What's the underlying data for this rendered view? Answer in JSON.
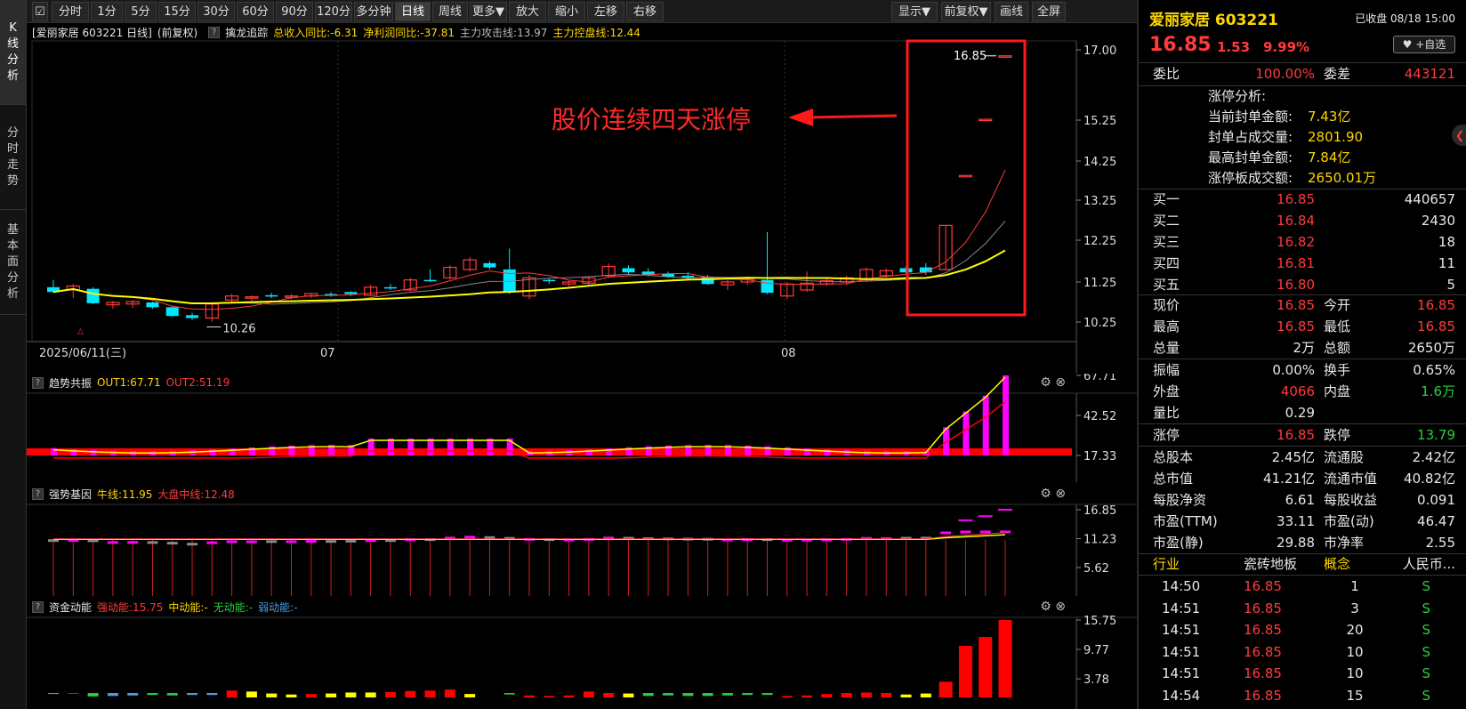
{
  "left_tabs": [
    {
      "chars": [
        "K",
        "线",
        "分",
        "析"
      ]
    },
    {
      "chars": [
        "分",
        "时",
        "走",
        "势"
      ]
    },
    {
      "chars": [
        "基",
        "本",
        "面",
        "分",
        "析"
      ]
    }
  ],
  "toolbar": {
    "items": [
      "分时",
      "1分",
      "5分",
      "15分",
      "30分",
      "60分",
      "90分",
      "120分",
      "多分钟",
      "日线",
      "周线",
      "更多▼",
      "放大",
      "缩小",
      "左移",
      "右移"
    ],
    "right": [
      "显示▼",
      "前复权▼",
      "画线",
      "全屏"
    ],
    "active": "日线"
  },
  "main": {
    "title": "[爱丽家居 603221 日线]",
    "adj": "(前复权)",
    "qmark": "?",
    "indicator_name": "擒龙追踪",
    "ind1": "总收入同比:-6.31",
    "ind2": "净利润同比:-37.81",
    "ind3": "主力攻击线:13.97",
    "ind4": "主力控盘线:12.44",
    "y_ticks": [
      "17.00",
      "15.25",
      "14.25",
      "13.25",
      "12.25",
      "11.25",
      "10.25"
    ],
    "x_labels": [
      "2025/06/11(三)",
      "07",
      "08"
    ],
    "low_label": "10.26",
    "high_label": "16.85",
    "annotation": "股价连续四天涨停"
  },
  "chart_data": {
    "type": "candlestick",
    "y_ticks": [
      10.25,
      11.25,
      12.25,
      13.25,
      14.25,
      15.25,
      17.0
    ],
    "candles": [
      {
        "o": 11.12,
        "h": 11.3,
        "l": 10.98,
        "c": 11.0
      },
      {
        "o": 11.05,
        "h": 11.2,
        "l": 10.85,
        "c": 11.15
      },
      {
        "o": 11.08,
        "h": 11.12,
        "l": 10.7,
        "c": 10.72
      },
      {
        "o": 10.68,
        "h": 10.78,
        "l": 10.58,
        "c": 10.74
      },
      {
        "o": 10.7,
        "h": 10.8,
        "l": 10.6,
        "c": 10.76
      },
      {
        "o": 10.74,
        "h": 10.76,
        "l": 10.58,
        "c": 10.62
      },
      {
        "o": 10.62,
        "h": 10.64,
        "l": 10.38,
        "c": 10.4
      },
      {
        "o": 10.42,
        "h": 10.48,
        "l": 10.3,
        "c": 10.35
      },
      {
        "o": 10.35,
        "h": 10.75,
        "l": 10.26,
        "c": 10.7
      },
      {
        "o": 10.8,
        "h": 10.95,
        "l": 10.75,
        "c": 10.9
      },
      {
        "o": 10.85,
        "h": 10.92,
        "l": 10.78,
        "c": 10.88
      },
      {
        "o": 10.92,
        "h": 10.98,
        "l": 10.85,
        "c": 10.9
      },
      {
        "o": 10.9,
        "h": 10.95,
        "l": 10.82,
        "c": 10.9
      },
      {
        "o": 10.9,
        "h": 10.98,
        "l": 10.85,
        "c": 10.96
      },
      {
        "o": 10.95,
        "h": 11.0,
        "l": 10.88,
        "c": 10.93
      },
      {
        "o": 11.0,
        "h": 11.02,
        "l": 10.9,
        "c": 10.95
      },
      {
        "o": 10.92,
        "h": 11.18,
        "l": 10.9,
        "c": 11.12
      },
      {
        "o": 11.12,
        "h": 11.2,
        "l": 11.05,
        "c": 11.1
      },
      {
        "o": 11.05,
        "h": 11.35,
        "l": 11.02,
        "c": 11.3
      },
      {
        "o": 11.3,
        "h": 11.55,
        "l": 11.25,
        "c": 11.28
      },
      {
        "o": 11.35,
        "h": 11.65,
        "l": 11.3,
        "c": 11.6
      },
      {
        "o": 11.55,
        "h": 11.85,
        "l": 11.5,
        "c": 11.78
      },
      {
        "o": 11.7,
        "h": 11.75,
        "l": 11.55,
        "c": 11.6
      },
      {
        "o": 11.55,
        "h": 12.05,
        "l": 10.95,
        "c": 11.0
      },
      {
        "o": 10.9,
        "h": 11.42,
        "l": 10.82,
        "c": 11.35
      },
      {
        "o": 11.3,
        "h": 11.35,
        "l": 11.2,
        "c": 11.28
      },
      {
        "o": 11.2,
        "h": 11.28,
        "l": 11.15,
        "c": 11.25
      },
      {
        "o": 11.22,
        "h": 11.38,
        "l": 11.18,
        "c": 11.35
      },
      {
        "o": 11.4,
        "h": 11.7,
        "l": 11.35,
        "c": 11.62
      },
      {
        "o": 11.58,
        "h": 11.65,
        "l": 11.42,
        "c": 11.48
      },
      {
        "o": 11.5,
        "h": 11.58,
        "l": 11.38,
        "c": 11.42
      },
      {
        "o": 11.45,
        "h": 11.5,
        "l": 11.35,
        "c": 11.38
      },
      {
        "o": 11.4,
        "h": 11.48,
        "l": 11.32,
        "c": 11.36
      },
      {
        "o": 11.38,
        "h": 11.42,
        "l": 11.18,
        "c": 11.2
      },
      {
        "o": 11.18,
        "h": 11.3,
        "l": 11.05,
        "c": 11.25
      },
      {
        "o": 11.25,
        "h": 11.38,
        "l": 11.18,
        "c": 11.32
      },
      {
        "o": 11.3,
        "h": 12.45,
        "l": 10.95,
        "c": 10.98
      },
      {
        "o": 10.9,
        "h": 11.25,
        "l": 10.82,
        "c": 11.2
      },
      {
        "o": 11.05,
        "h": 11.5,
        "l": 11.0,
        "c": 11.22
      },
      {
        "o": 11.2,
        "h": 11.35,
        "l": 11.15,
        "c": 11.28
      },
      {
        "o": 11.25,
        "h": 11.4,
        "l": 11.18,
        "c": 11.35
      },
      {
        "o": 11.3,
        "h": 11.6,
        "l": 11.25,
        "c": 11.55
      },
      {
        "o": 11.4,
        "h": 11.58,
        "l": 11.35,
        "c": 11.52
      },
      {
        "o": 11.58,
        "h": 11.62,
        "l": 11.45,
        "c": 11.48
      },
      {
        "o": 11.6,
        "h": 11.7,
        "l": 11.42,
        "c": 11.48
      },
      {
        "o": 11.55,
        "h": 12.62,
        "l": 11.52,
        "c": 12.62
      },
      {
        "o": 13.88,
        "h": 13.88,
        "l": 13.88,
        "c": 13.88
      },
      {
        "o": 15.27,
        "h": 15.27,
        "l": 15.27,
        "c": 15.27
      },
      {
        "o": 16.85,
        "h": 16.85,
        "l": 16.85,
        "c": 16.85
      }
    ]
  },
  "ind_trend": {
    "name": "趋势共振",
    "out1": "OUT1:67.71",
    "out2": "OUT2:51.19",
    "ticks": [
      "67.71",
      "42.52",
      "17.33"
    ]
  },
  "ind_strong": {
    "name": "强势基因",
    "niu": "牛线:11.95",
    "dapan": "大盘中线:12.48",
    "ticks": [
      "16.85",
      "11.23",
      "5.62"
    ]
  },
  "ind_fund": {
    "name": "资金动能",
    "strong": "强动能:15.75",
    "mid": "中动能:-",
    "none": "无动能:-",
    "weak": "弱动能:-",
    "ticks": [
      "15.75",
      "9.77",
      "3.78"
    ]
  },
  "rp": {
    "name": "爱丽家居",
    "code": "603221",
    "status": "已收盘 08/18 15:00",
    "price": "16.85",
    "change": "1.53",
    "pct": "9.99%",
    "fav": "♥ +自选",
    "weibi_l": "委比",
    "weibi_v": "100.00%",
    "weicha_l": "委差",
    "weicha_v": "443121",
    "zt_title": "涨停分析:",
    "zt": [
      {
        "l": "当前封单金额:",
        "v": "7.43亿"
      },
      {
        "l": "封单占成交量:",
        "v": "2801.90"
      },
      {
        "l": "最高封单金额:",
        "v": "7.84亿"
      },
      {
        "l": "涨停板成交额:",
        "v": "2650.01万"
      }
    ],
    "bids": [
      {
        "l": "买一",
        "p": "16.85",
        "v": "440657"
      },
      {
        "l": "买二",
        "p": "16.84",
        "v": "2430"
      },
      {
        "l": "买三",
        "p": "16.82",
        "v": "18"
      },
      {
        "l": "买四",
        "p": "16.81",
        "v": "11"
      },
      {
        "l": "买五",
        "p": "16.80",
        "v": "5"
      }
    ],
    "q1": [
      {
        "l": "现价",
        "v": "16.85",
        "l2": "今开",
        "v2": "16.85"
      },
      {
        "l": "最高",
        "v": "16.85",
        "l2": "最低",
        "v2": "16.85"
      },
      {
        "l": "总量",
        "v": "2万",
        "l2": "总额",
        "v2": "2650万"
      }
    ],
    "q2": [
      {
        "l": "振幅",
        "v": "0.00%",
        "l2": "换手",
        "v2": "0.65%"
      },
      {
        "l": "外盘",
        "v": "4066",
        "l2": "内盘",
        "v2": "1.6万"
      },
      {
        "l": "量比",
        "v": "0.29",
        "l2": "",
        "v2": ""
      }
    ],
    "q3": [
      {
        "l": "涨停",
        "v": "16.85",
        "l2": "跌停",
        "v2": "13.79"
      }
    ],
    "q4": [
      {
        "l": "总股本",
        "v": "2.45亿",
        "l2": "流通股",
        "v2": "2.42亿"
      },
      {
        "l": "总市值",
        "v": "41.21亿",
        "l2": "流通市值",
        "v2": "40.82亿"
      },
      {
        "l": "每股净资",
        "v": "6.61",
        "l2": "每股收益",
        "v2": "0.091"
      },
      {
        "l": "市盈(TTM)",
        "v": "33.11",
        "l2": "市盈(动)",
        "v2": "46.47"
      },
      {
        "l": "市盈(静)",
        "v": "29.88",
        "l2": "市净率",
        "v2": "2.55"
      }
    ],
    "industry_l": "行业",
    "industry_v": "瓷砖地板",
    "concept_l": "概念",
    "concept_v": "人民币...",
    "ticks": [
      {
        "t": "14:50",
        "p": "16.85",
        "v": "1",
        "s": "S"
      },
      {
        "t": "14:51",
        "p": "16.85",
        "v": "3",
        "s": "S"
      },
      {
        "t": "14:51",
        "p": "16.85",
        "v": "20",
        "s": "S"
      },
      {
        "t": "14:51",
        "p": "16.85",
        "v": "10",
        "s": "S"
      },
      {
        "t": "14:51",
        "p": "16.85",
        "v": "10",
        "s": "S"
      },
      {
        "t": "14:54",
        "p": "16.85",
        "v": "15",
        "s": "S"
      }
    ]
  }
}
